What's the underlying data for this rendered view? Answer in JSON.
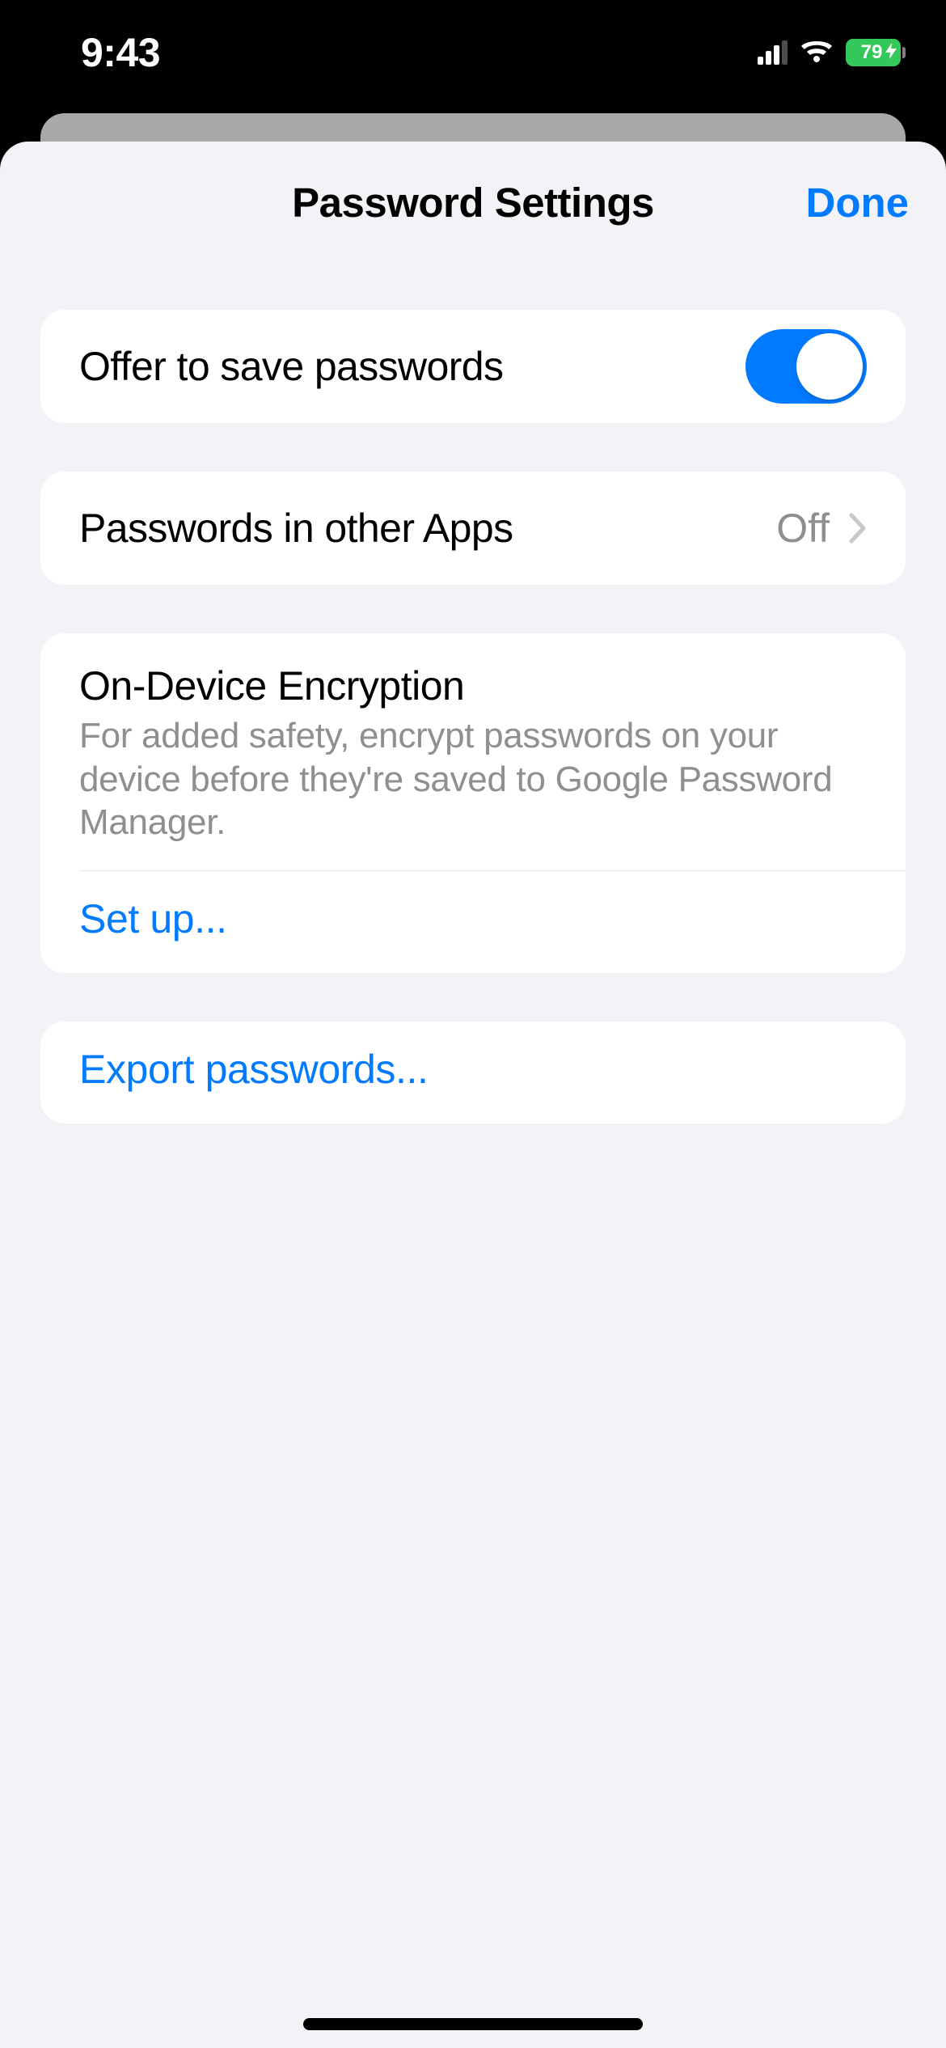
{
  "status": {
    "time": "9:43",
    "battery": "79"
  },
  "sheet": {
    "title": "Password Settings",
    "done": "Done"
  },
  "rows": {
    "offer_save": "Offer to save passwords",
    "other_apps_label": "Passwords in other Apps",
    "other_apps_value": "Off"
  },
  "encryption": {
    "title": "On-Device Encryption",
    "description": "For added safety, encrypt passwords on your device before they're saved to Google Password Manager.",
    "setup": "Set up..."
  },
  "export": {
    "label": "Export passwords..."
  }
}
